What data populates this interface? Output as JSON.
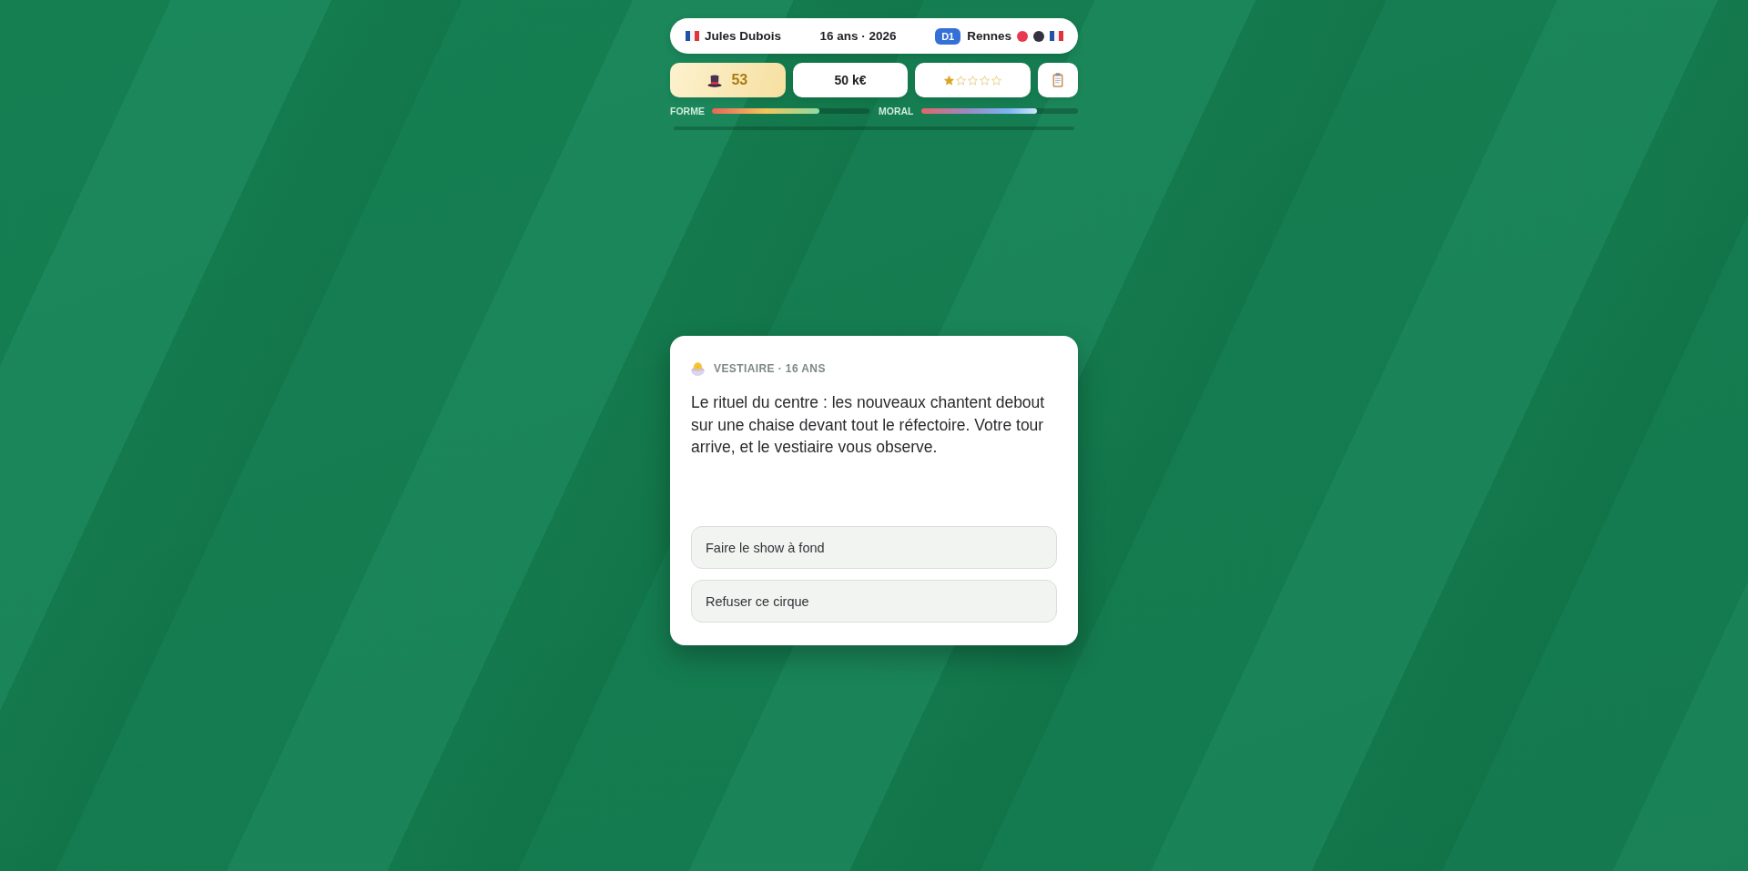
{
  "player_bar": {
    "name": "Jules Dubois",
    "age_year": "16 ans · 2026",
    "league": "D1",
    "club": "Rennes",
    "club_colors": [
      {
        "color": "#e8394f"
      },
      {
        "color": "#34323f"
      }
    ]
  },
  "stats": {
    "rating": "53",
    "money": "50 k€",
    "stars": 1
  },
  "gauges": [
    {
      "kind": "form",
      "label": "FORME",
      "level": 0.68
    },
    {
      "kind": "morale",
      "label": "MORAL",
      "level": 0.74
    }
  ],
  "event": {
    "tag": "VESTIAIRE · 16 ANS",
    "text": "Le rituel du centre : les nouveaux chantent debout sur une chaise devant tout le réfectoire. Votre tour arrive, et le vestiaire vous observe.",
    "choices": [
      {
        "label": "Faire le show à fond"
      },
      {
        "label": "Refuser ce cirque"
      }
    ]
  }
}
